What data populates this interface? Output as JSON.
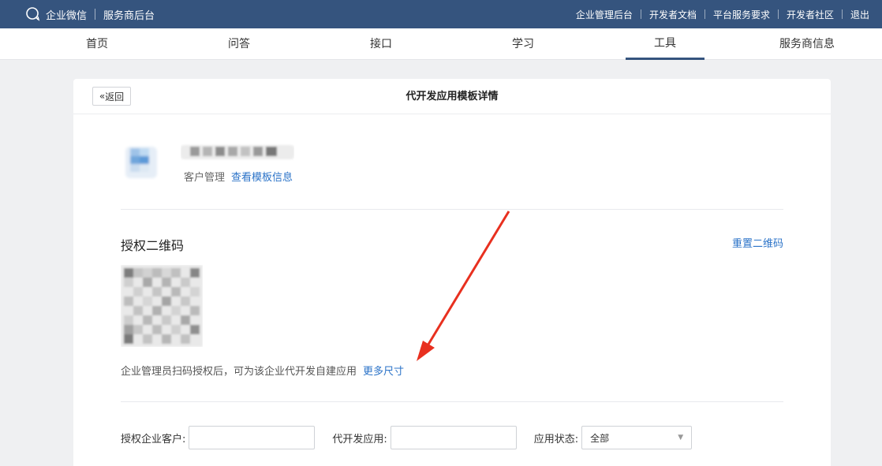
{
  "topbar": {
    "brand": "企业微信",
    "subtitle": "服务商后台",
    "links": [
      "企业管理后台",
      "开发者文档",
      "平台服务要求",
      "开发者社区",
      "退出"
    ]
  },
  "nav": {
    "tabs": [
      "首页",
      "问答",
      "接口",
      "学习",
      "工具",
      "服务商信息"
    ],
    "active": "工具"
  },
  "header": {
    "back_label": "返回",
    "back_icon": "double-chevron-left-icon",
    "title": "代开发应用模板详情"
  },
  "app": {
    "category": "客户管理",
    "view_template_link": "查看模板信息"
  },
  "qr": {
    "title": "授权二维码",
    "reset_link": "重置二维码",
    "description": "企业管理员扫码授权后，可为该企业代开发自建应用",
    "more_sizes_link": "更多尺寸"
  },
  "filters": {
    "customer_label": "授权企业客户:",
    "customer_value": "",
    "app_label": "代开发应用:",
    "app_value": "",
    "status_label": "应用状态:",
    "status_value": "全部"
  },
  "colors": {
    "topbar": "#35547e",
    "link": "#2b73c8",
    "arrow": "#e8301f"
  }
}
